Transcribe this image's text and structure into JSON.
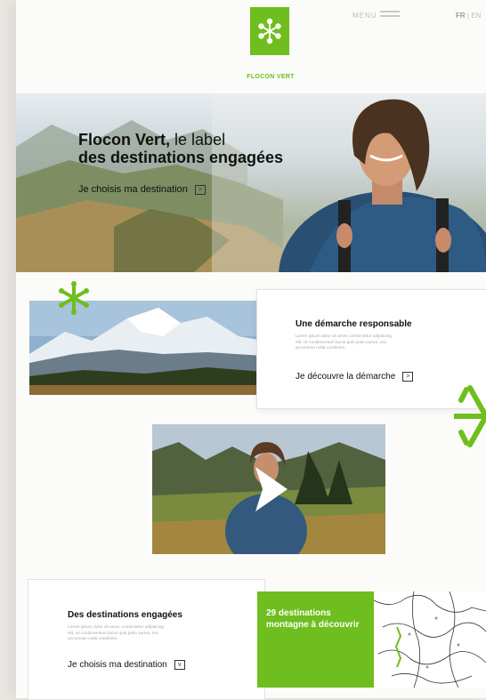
{
  "header": {
    "logo_caption": "FLOCON VERT",
    "menu_label": "MENU",
    "lang_fr": "FR",
    "lang_sep": " | ",
    "lang_en": "EN"
  },
  "hero": {
    "title_brand": "Flocon Vert,",
    "title_rest": " le label",
    "title_line2": "des destinations engagées",
    "cta": "Je choisis ma destination",
    "cta_icon": ">"
  },
  "approach": {
    "title": "Une démarche responsable",
    "body": "Lorem ipsum dolor sit amet, consectetur adipiscing elit. Ut condimentum lacus quis justo varius, nec accumsan nulla condimen.",
    "cta": "Je découvre la démarche",
    "cta_icon": ">"
  },
  "destinations": {
    "title": "Des destinations engagées",
    "body": "Lorem ipsum dolor sit amet, consectetur adipiscing elit. Ut condimentum lacus quis justo varius, nec accumsan nulla condimen.",
    "cta": "Je choisis ma destination",
    "cta_icon": "v",
    "promo": "29 destinations montagne à découvrir"
  },
  "colors": {
    "brand_green": "#6fbe1f"
  },
  "icons": [
    "snowflake-logo-icon",
    "menu-icon",
    "chevron-right-icon",
    "chevron-down-icon",
    "play-icon",
    "snowflake-decoration-icon"
  ]
}
